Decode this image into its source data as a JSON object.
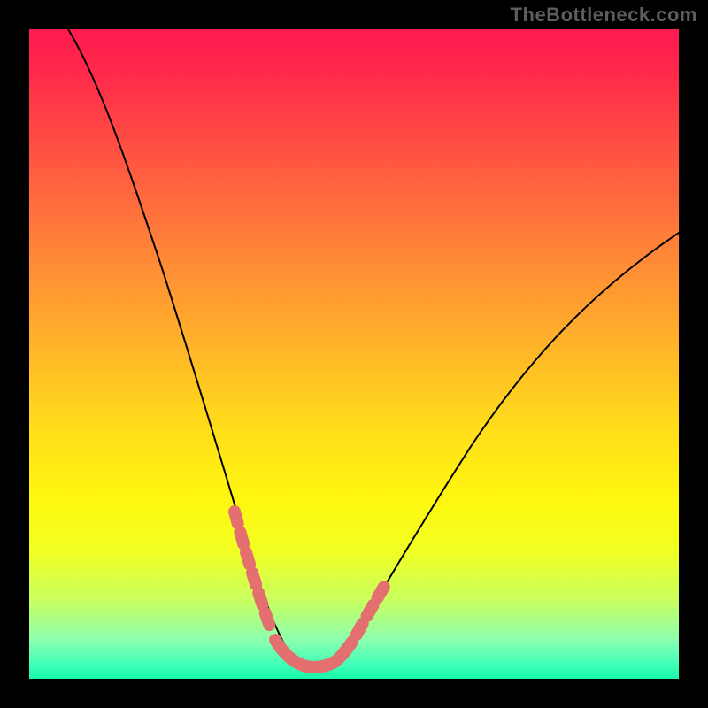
{
  "watermark": "TheBottleneck.com",
  "colors": {
    "background": "#000000",
    "gradient_top": "#ff1a50",
    "gradient_bottom": "#18f7a7",
    "curve_stroke": "#000000",
    "marker_stroke": "#e46f6f"
  },
  "chart_data": {
    "type": "line",
    "title": "",
    "xlabel": "",
    "ylabel": "",
    "xlim": [
      0,
      100
    ],
    "ylim": [
      0,
      100
    ],
    "series": [
      {
        "name": "bottleneck-curve",
        "x": [
          6,
          10,
          14,
          18,
          22,
          25,
          28,
          30,
          32,
          34,
          36,
          38,
          40,
          42,
          44,
          46,
          48,
          52,
          56,
          60,
          65,
          70,
          75,
          80,
          85,
          90,
          95,
          100
        ],
        "y": [
          100,
          87,
          75,
          64,
          53,
          45,
          37,
          31,
          25,
          19,
          13,
          8,
          4,
          2,
          1,
          1,
          2,
          5,
          9,
          14,
          20,
          26,
          32,
          38,
          44,
          50,
          56,
          62
        ]
      }
    ],
    "annotations": [
      {
        "name": "left-descent-marker",
        "x_range": [
          31,
          36
        ],
        "style": "dashed"
      },
      {
        "name": "trough-marker",
        "x_range": [
          38,
          48
        ],
        "style": "solid"
      },
      {
        "name": "right-ascent-marker",
        "x_range": [
          49,
          53
        ],
        "style": "dashed"
      }
    ]
  }
}
